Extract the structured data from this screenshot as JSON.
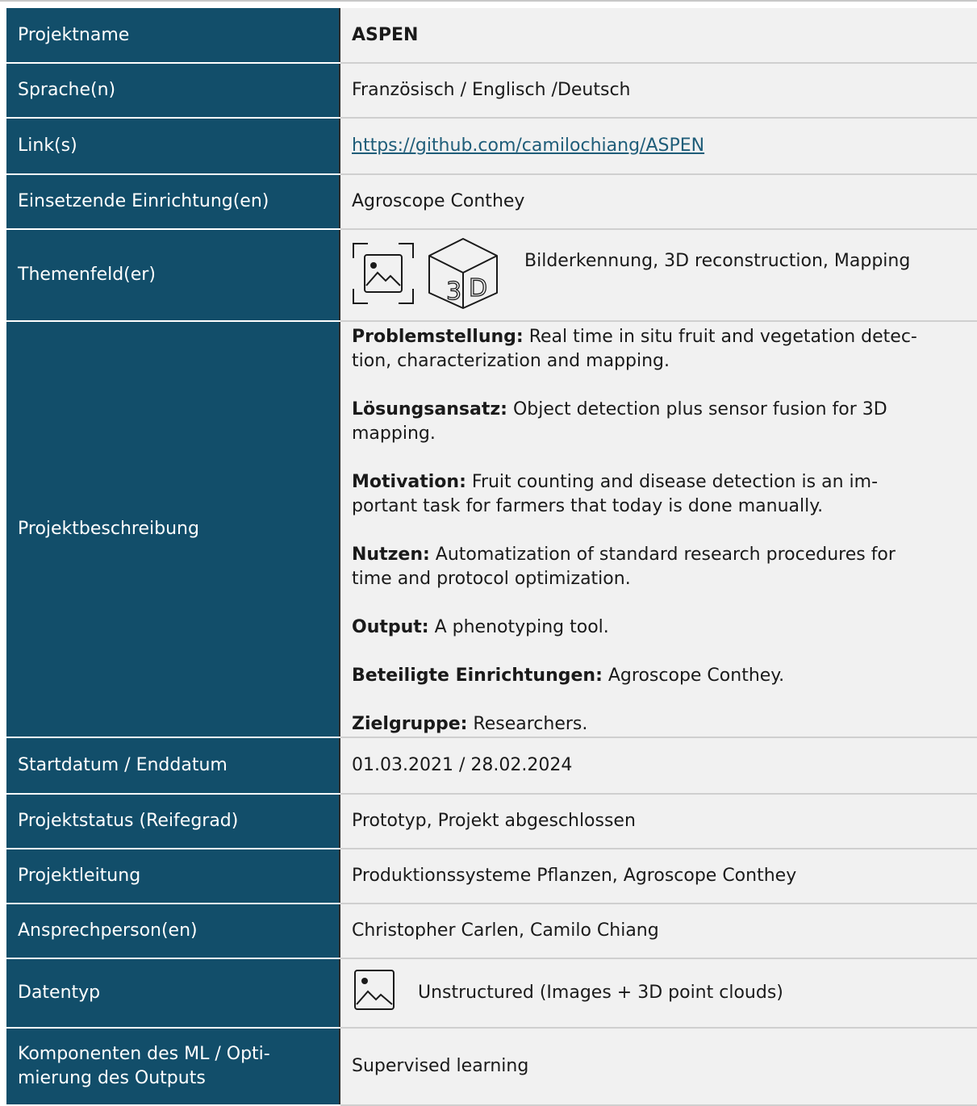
{
  "rows": [
    {
      "label": "Projektname",
      "value": "ASPEN"
    },
    {
      "label": "Sprache(n)",
      "value": "Französisch / Englisch /Deutsch"
    },
    {
      "label": "Link(s)",
      "value": "https://github.com/camilochiang/ASPEN"
    },
    {
      "label": "Einsetzende Einrichtung(en)",
      "value": "Agroscope Conthey"
    },
    {
      "label": "Themenfeld(er)",
      "value": "Bilderkennung, 3D reconstruction, Mapping",
      "icons": [
        "image-recognition-icon",
        "3d-cube-icon"
      ]
    },
    {
      "label": "Projektbeschreibung"
    },
    {
      "label": "Startdatum / Enddatum",
      "value": "01.03.2021 / 28.02.2024"
    },
    {
      "label": "Projektstatus (Reifegrad)",
      "value": "Prototyp, Projekt abgeschlossen"
    },
    {
      "label": "Projektleitung",
      "value": "Produktionssysteme Pflanzen, Agroscope Conthey"
    },
    {
      "label": "Ansprechperson(en)",
      "value": "Christopher Carlen, Camilo Chiang"
    },
    {
      "label": "Datentyp",
      "value": "Unstructured (Images + 3D point clouds)",
      "icons": [
        "image-icon"
      ]
    },
    {
      "label_line1": "Komponenten des ML / Opti-",
      "label_line2": "mierung des Outputs",
      "value": "Supervised learning"
    }
  ],
  "description": [
    {
      "key": "Problemstellung:",
      "line1": " Real time in situ fruit and vegetation detec-",
      "line2": "tion, characterization and mapping."
    },
    {
      "key": "Lösungsansatz:",
      "line1": " Object detection plus sensor fusion for 3D",
      "line2": "mapping."
    },
    {
      "key": "Motivation:",
      "line1": " Fruit counting and disease detection is an im-",
      "line2": "portant task for farmers that today is done manually."
    },
    {
      "key": "Nutzen:",
      "line1": " Automatization of standard research procedures for",
      "line2": "time and protocol optimization."
    },
    {
      "key": "Output:",
      "line1": " A phenotyping tool.",
      "line2": ""
    },
    {
      "key": "Beteiligte Einrichtungen:",
      "line1": " Agroscope Conthey.",
      "line2": ""
    },
    {
      "key": "Zielgruppe:",
      "line1": " Researchers.",
      "line2": ""
    }
  ],
  "colors": {
    "label_bg": "#124e6a",
    "value_bg": "#f1f1f1",
    "link": "#1f5d79"
  }
}
